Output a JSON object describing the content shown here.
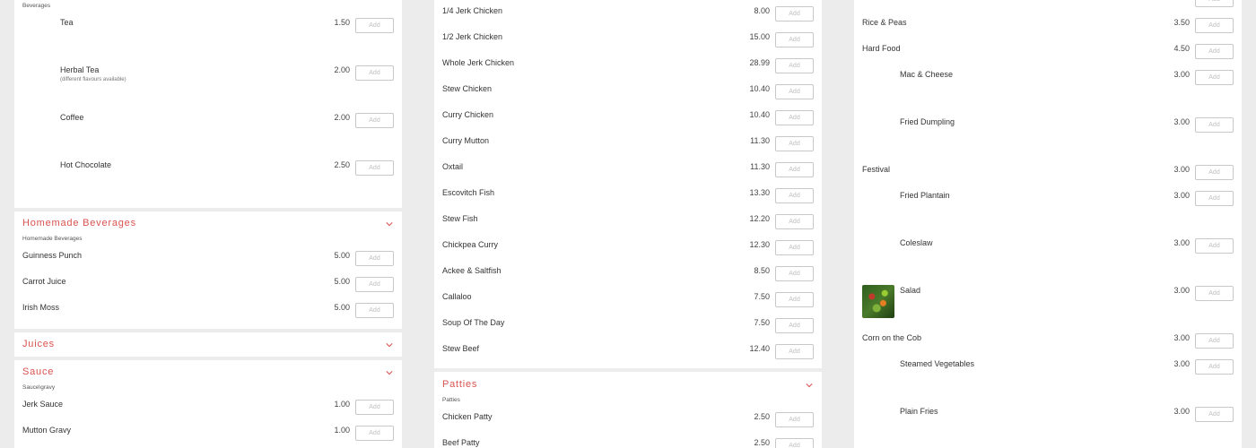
{
  "add_label": "Add",
  "left": {
    "beverages_sub": "Beverages",
    "beverages": [
      {
        "name": "Tea",
        "note": "",
        "price": "1.50"
      },
      {
        "name": "Herbal Tea",
        "note": "(different flavours available)",
        "price": "2.00"
      },
      {
        "name": "Coffee",
        "note": "",
        "price": "2.00"
      },
      {
        "name": "Hot Chocolate",
        "note": "",
        "price": "2.50"
      }
    ],
    "homemade_title": "Homemade Beverages",
    "homemade_sub": "Homemade Beverages",
    "homemade": [
      {
        "name": "Guinness Punch",
        "price": "5.00"
      },
      {
        "name": "Carrot Juice",
        "price": "5.00"
      },
      {
        "name": "Irish Moss",
        "price": "5.00"
      }
    ],
    "juices_title": "Juices",
    "sauce_title": "Sauce",
    "sauce_sub": "Sauce\\gravy",
    "sauces": [
      {
        "name": "Jerk Sauce",
        "price": "1.00"
      },
      {
        "name": "Mutton Gravy",
        "price": "1.00"
      }
    ]
  },
  "mid": {
    "mains": [
      {
        "name": "1/4 Jerk Chicken",
        "price": "8.00"
      },
      {
        "name": "1/2 Jerk Chicken",
        "price": "15.00"
      },
      {
        "name": "Whole Jerk Chicken",
        "price": "28.99"
      },
      {
        "name": "Stew Chicken",
        "price": "10.40"
      },
      {
        "name": "Curry Chicken",
        "price": "10.40"
      },
      {
        "name": "Curry Mutton",
        "price": "11.30"
      },
      {
        "name": "Oxtail",
        "price": "11.30"
      },
      {
        "name": "Escovitch Fish",
        "price": "13.30"
      },
      {
        "name": "Stew Fish",
        "price": "12.20"
      },
      {
        "name": "Chickpea Curry",
        "price": "12.30"
      },
      {
        "name": "Ackee & Saltfish",
        "price": "8.50"
      },
      {
        "name": "Callaloo",
        "price": "7.50"
      },
      {
        "name": "Soup Of The Day",
        "price": "7.50"
      },
      {
        "name": "Stew Beef",
        "price": "12.40"
      }
    ],
    "patties_title": "Patties",
    "patties_sub": "Patties",
    "patties": [
      {
        "name": "Chicken Patty",
        "price": "2.50"
      },
      {
        "name": "Beef Patty",
        "price": "2.50"
      }
    ]
  },
  "right": {
    "sides": [
      {
        "name": "Rice & Peas",
        "price": "3.50"
      },
      {
        "name": "Hard Food",
        "price": "4.50"
      },
      {
        "name": "Mac & Cheese",
        "price": "3.00"
      },
      {
        "name": "Fried Dumpling",
        "price": "3.00"
      },
      {
        "name": "Festival",
        "price": "3.00"
      },
      {
        "name": "Fried Plantain",
        "price": "3.00"
      },
      {
        "name": "Coleslaw",
        "price": "3.00"
      },
      {
        "name": "Salad",
        "price": "3.00"
      },
      {
        "name": "Corn on the Cob",
        "price": "3.00"
      },
      {
        "name": "Steamed Vegetables",
        "price": "3.00"
      },
      {
        "name": "Plain Fries",
        "price": "3.00"
      }
    ]
  }
}
